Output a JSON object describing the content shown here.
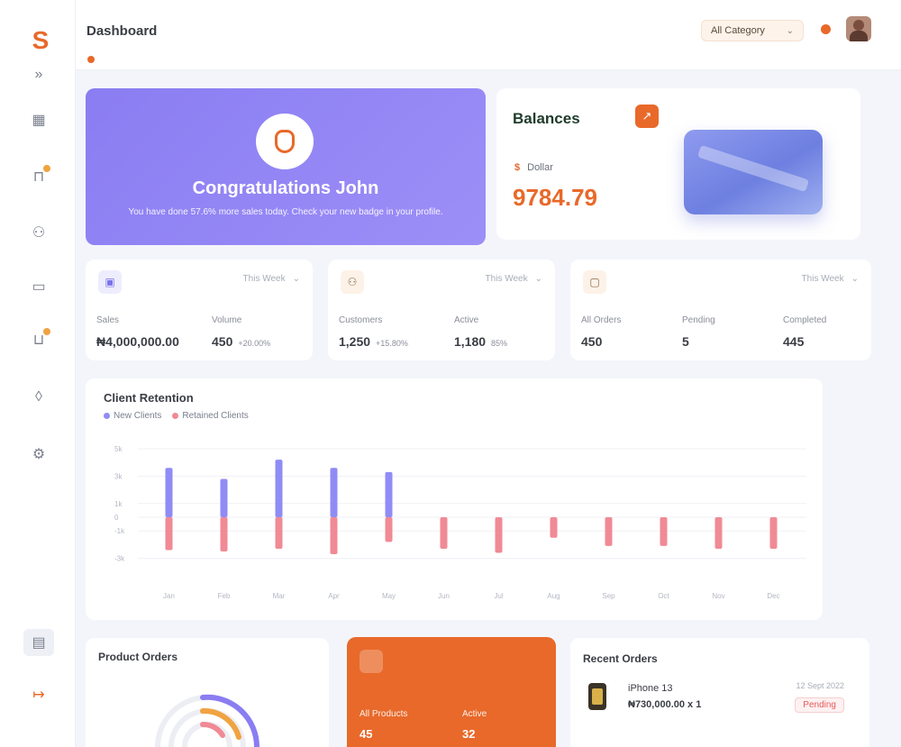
{
  "app": {
    "page_title": "Dashboard"
  },
  "colors": {
    "accent": "#e8692a",
    "primary": "#8a7df2",
    "danger": "#f08a95",
    "new_clients": "#8f8cf5"
  },
  "sidebar": {
    "logo": "S",
    "icons": [
      "collapse-icon",
      "grid-icon",
      "bag-icon",
      "users-icon",
      "folder-icon",
      "cart-icon",
      "tag-icon",
      "settings-icon",
      "store-icon",
      "logout-icon"
    ]
  },
  "header": {
    "category_select": {
      "value": "All Category"
    },
    "avatar": "user-avatar"
  },
  "congrats": {
    "title": "Congratulations John",
    "message": "You have done 57.6% more sales today. Check your new badge in your profile."
  },
  "balances": {
    "title": "Balances",
    "currency_symbol": "$",
    "currency_label": "Dollar",
    "amount": "9784.79"
  },
  "stats": [
    {
      "icon": "chart-icon",
      "range": "This Week",
      "metrics": [
        {
          "label": "Sales",
          "value": "₦4,000,000.00",
          "change": ""
        },
        {
          "label": "Volume",
          "value": "450",
          "change": "+20.00%"
        }
      ]
    },
    {
      "icon": "users-icon",
      "range": "This Week",
      "metrics": [
        {
          "label": "Customers",
          "value": "1,250",
          "change": "+15.80%"
        },
        {
          "label": "Active",
          "value": "1,180",
          "change": "85%"
        }
      ]
    },
    {
      "icon": "box-icon",
      "range": "This Week",
      "metrics": [
        {
          "label": "All Orders",
          "value": "450",
          "change": ""
        },
        {
          "label": "Pending",
          "value": "5",
          "change": ""
        },
        {
          "label": "Completed",
          "value": "445",
          "change": ""
        }
      ]
    }
  ],
  "chart_data": {
    "type": "bar",
    "title": "Client Retention",
    "series": [
      {
        "name": "New Clients",
        "values": [
          3.6,
          2.8,
          4.2,
          3.6,
          3.3,
          0,
          0,
          0,
          0,
          0,
          0,
          0
        ]
      },
      {
        "name": "Retained Clients",
        "values": [
          -2.4,
          -2.5,
          -2.3,
          -2.7,
          -1.8,
          -2.3,
          -2.6,
          -1.5,
          -2.1,
          -2.1,
          -2.3,
          -2.3
        ]
      }
    ],
    "categories": [
      "Jan",
      "Feb",
      "Mar",
      "Apr",
      "May",
      "Jun",
      "Jul",
      "Aug",
      "Sep",
      "Oct",
      "Nov",
      "Dec"
    ],
    "ylim": [
      -5,
      5
    ],
    "yticks": [
      "5k",
      "3k",
      "1k",
      "0",
      "-1k",
      "-3k"
    ],
    "grid": true,
    "legend": "top-left"
  },
  "product_orders": {
    "title": "Product Orders"
  },
  "products_card": {
    "metrics": [
      {
        "label": "All Products",
        "value": "45"
      },
      {
        "label": "Active",
        "value": "32"
      }
    ]
  },
  "recent_orders": {
    "title": "Recent Orders",
    "items": [
      {
        "name": "iPhone 13",
        "price": "₦730,000.00 x 1",
        "date": "12 Sept 2022",
        "status": "Pending"
      }
    ]
  }
}
